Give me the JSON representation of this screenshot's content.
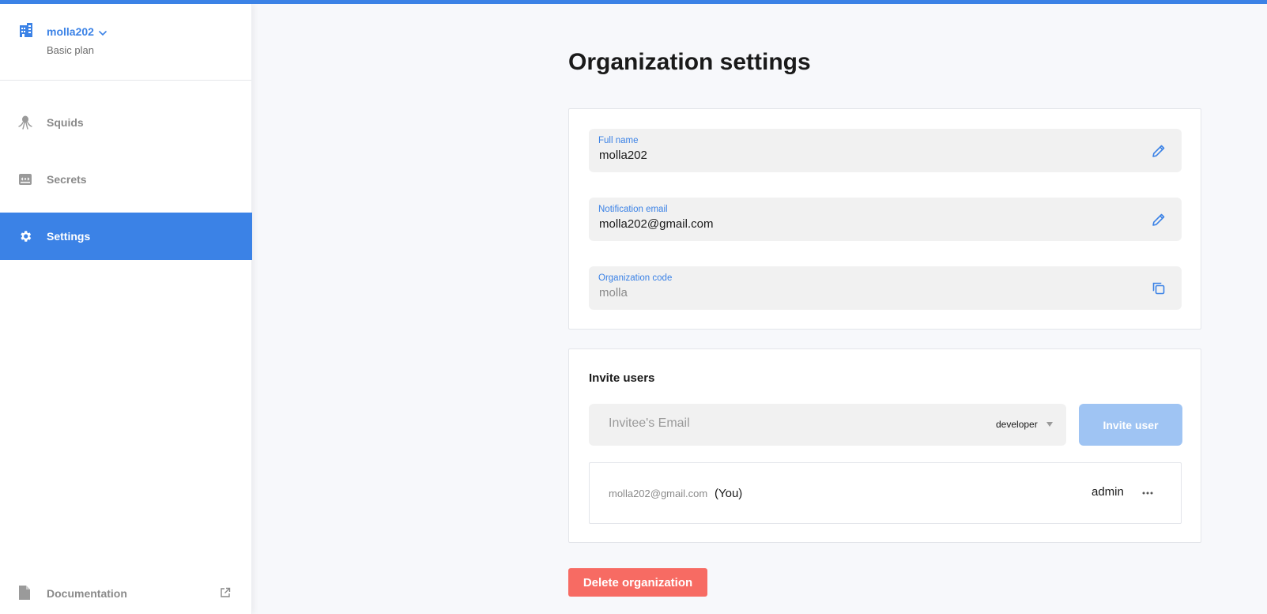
{
  "sidebar": {
    "org_name": "molla202",
    "org_plan": "Basic plan",
    "items": [
      {
        "label": "Squids"
      },
      {
        "label": "Secrets"
      },
      {
        "label": "Settings"
      }
    ],
    "documentation_label": "Documentation"
  },
  "page": {
    "title": "Organization settings"
  },
  "fields": {
    "full_name": {
      "label": "Full name",
      "value": "molla202"
    },
    "notification_email": {
      "label": "Notification email",
      "value": "molla202@gmail.com"
    },
    "organization_code": {
      "label": "Organization code",
      "value": "molla"
    }
  },
  "invite": {
    "title": "Invite users",
    "email_placeholder": "Invitee's Email",
    "role_selected": "developer",
    "button_label": "Invite user"
  },
  "members": [
    {
      "email": "molla202@gmail.com",
      "you_label": "(You)",
      "role": "admin"
    }
  ],
  "delete_button_label": "Delete organization",
  "colors": {
    "accent": "#3b82e6",
    "invite_button_disabled": "#9fc4f3",
    "danger": "#f76b63"
  }
}
